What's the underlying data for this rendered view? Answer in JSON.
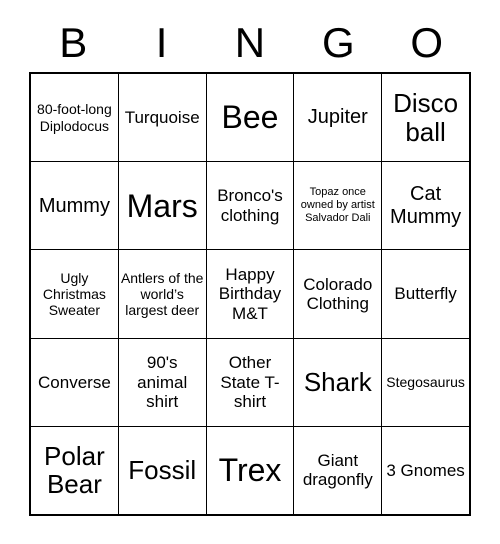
{
  "card": {
    "header_letters": [
      "B",
      "I",
      "N",
      "G",
      "O"
    ],
    "rows": [
      [
        {
          "text": "80-foot-long Diplodocus",
          "size": "fs-sm"
        },
        {
          "text": "Turquoise",
          "size": "fs-md"
        },
        {
          "text": "Bee",
          "size": "fs-xxl"
        },
        {
          "text": "Jupiter",
          "size": "fs-lg"
        },
        {
          "text": "Disco ball",
          "size": "fs-xl"
        }
      ],
      [
        {
          "text": "Mummy",
          "size": "fs-lg"
        },
        {
          "text": "Mars",
          "size": "fs-xxl"
        },
        {
          "text": "Bronco's clothing",
          "size": "fs-md"
        },
        {
          "text": "Topaz once owned by artist Salvador Dali",
          "size": "fs-xs"
        },
        {
          "text": "Cat Mummy",
          "size": "fs-lg"
        }
      ],
      [
        {
          "text": "Ugly Christmas Sweater",
          "size": "fs-sm"
        },
        {
          "text": "Antlers of the world’s largest deer",
          "size": "fs-sm"
        },
        {
          "text": "Happy Birthday M&T",
          "size": "fs-md"
        },
        {
          "text": "Colorado Clothing",
          "size": "fs-md"
        },
        {
          "text": "Butterfly",
          "size": "fs-md"
        }
      ],
      [
        {
          "text": "Converse",
          "size": "fs-md"
        },
        {
          "text": "90's animal shirt",
          "size": "fs-md"
        },
        {
          "text": "Other State T-shirt",
          "size": "fs-md"
        },
        {
          "text": "Shark",
          "size": "fs-xl"
        },
        {
          "text": "Stegosaurus",
          "size": "fs-sm"
        }
      ],
      [
        {
          "text": "Polar Bear",
          "size": "fs-xl"
        },
        {
          "text": "Fossil",
          "size": "fs-xl"
        },
        {
          "text": "Trex",
          "size": "fs-xxl"
        },
        {
          "text": "Giant dragonfly",
          "size": "fs-md"
        },
        {
          "text": "3 Gnomes",
          "size": "fs-md"
        }
      ]
    ]
  },
  "colors": {
    "background": "#ffffff",
    "text": "#000000",
    "border": "#000000"
  }
}
